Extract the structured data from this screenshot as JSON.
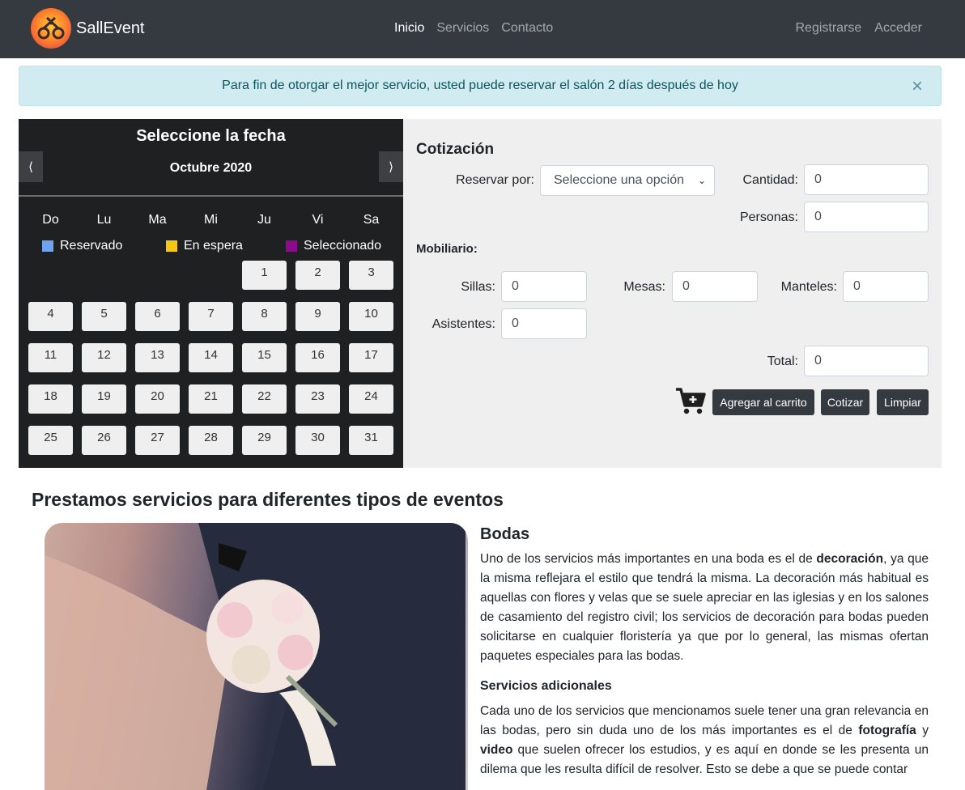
{
  "navbar": {
    "brand": "SallEvent",
    "links": [
      "Inicio",
      "Servicios",
      "Contacto"
    ],
    "active_link": "Inicio",
    "right_links": [
      "Registrarse",
      "Acceder"
    ]
  },
  "alert": {
    "message": "Para fin de otorgar el mejor servicio, usted puede reservar el salón 2 días después de hoy",
    "close": "×"
  },
  "calendar": {
    "title": "Seleccione la fecha",
    "prev": "⟨",
    "next": "⟩",
    "month": "Octubre 2020",
    "weekdays": [
      "Do",
      "Lu",
      "Ma",
      "Mi",
      "Ju",
      "Vi",
      "Sa"
    ],
    "legend": [
      {
        "label": "Reservado",
        "color": "#6fa3ef"
      },
      {
        "label": "En espera",
        "color": "#f5c518"
      },
      {
        "label": "Seleccionado",
        "color": "#8b0b8b"
      }
    ],
    "first_weekday": 4,
    "days": [
      "1",
      "2",
      "3",
      "4",
      "5",
      "6",
      "7",
      "8",
      "9",
      "10",
      "11",
      "12",
      "13",
      "14",
      "15",
      "16",
      "17",
      "18",
      "19",
      "20",
      "21",
      "22",
      "23",
      "24",
      "25",
      "26",
      "27",
      "28",
      "29",
      "30",
      "31"
    ]
  },
  "quote": {
    "title": "Cotización",
    "reserve_label": "Reservar por:",
    "reserve_value": "Seleccione una opción",
    "cantidad_label": "Cantidad:",
    "cantidad_value": "0",
    "personas_label": "Personas:",
    "personas_value": "0",
    "mobiliario_label": "Mobiliario:",
    "sillas_label": "Sillas:",
    "sillas_value": "0",
    "mesas_label": "Mesas:",
    "mesas_value": "0",
    "manteles_label": "Manteles:",
    "manteles_value": "0",
    "asistentes_label": "Asistentes:",
    "asistentes_value": "0",
    "total_label": "Total:",
    "total_value": "0",
    "add_cart": "Agregar al carrito",
    "cotizar": "Cotizar",
    "limpiar": "Limpiar"
  },
  "services": {
    "title": "Prestamos servicios para diferentes tipos de eventos",
    "article_title": "Bodas",
    "p1_a": "Uno de los servicios más importantes en una boda es el de ",
    "p1_b": "decoración",
    "p1_c": ", ya que la misma reflejara el estilo que tendrá la misma. La decoración más habitual es aquellas con flores y velas que se suele apreciar en las iglesias y en los salones de casamiento del registro civil; los servicios de decoración para bodas pueden solicitarse en cualquier floristería ya que por lo general, las mismas ofertan paquetes especiales para las bodas.",
    "subheading": "Servicios adicionales",
    "p2_a": "Cada uno de los servicios que mencionamos suele tener una gran relevancia en las bodas, pero sin duda uno de los más importantes es el de ",
    "p2_b": "fotografía",
    "p2_c": " y ",
    "p2_d": "video",
    "p2_e": " que suelen ofrecer los estudios, y es aquí en donde se les presenta un dilema que les resulta difícil de resolver. Esto se debe a que se puede contar"
  }
}
